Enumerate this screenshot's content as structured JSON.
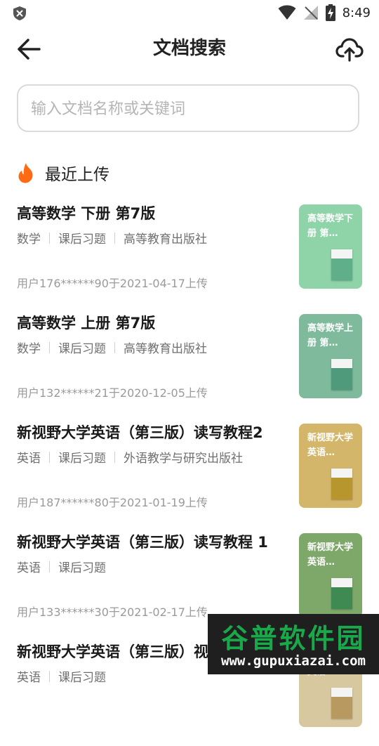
{
  "status_bar": {
    "time": "8:49"
  },
  "header": {
    "title": "文档搜索"
  },
  "search": {
    "placeholder": "输入文档名称或关键词"
  },
  "section": {
    "title": "最近上传"
  },
  "items": [
    {
      "title": "高等数学 下册 第7版",
      "tags": [
        "数学",
        "课后习题",
        "高等教育出版社"
      ],
      "meta": "用户176******90于2021-04-17上传",
      "thumb_title": "高等数学下册 第…",
      "thumb_color": "#8fd3a8",
      "book_color": "#5fb08a"
    },
    {
      "title": "高等数学 上册 第7版",
      "tags": [
        "数学",
        "课后习题",
        "高等教育出版社"
      ],
      "meta": "用户132******21于2020-12-05上传",
      "thumb_title": "高等数学上册 第…",
      "thumb_color": "#7fba9c",
      "book_color": "#4e9a7a"
    },
    {
      "title": "新视野大学英语（第三版）读写教程2",
      "tags": [
        "英语",
        "课后习题",
        "外语教学与研究出版社"
      ],
      "meta": "用户187******80于2021-01-19上传",
      "thumb_title": "新视野大学英语…",
      "thumb_color": "#d4b66a",
      "book_color": "#b8962e"
    },
    {
      "title": "新视野大学英语（第三版）读写教程 1",
      "tags": [
        "英语",
        "课后习题"
      ],
      "meta": "用户133******30于2021-02-17上传",
      "thumb_title": "新视野大学英语…",
      "thumb_color": "#7ea86a",
      "book_color": "#3f8a52"
    },
    {
      "title": "新视野大学英语（第三版）视听说",
      "tags": [
        "英语",
        "课后习题"
      ],
      "meta": "",
      "thumb_title": "新视野大学英语…",
      "thumb_color": "#d8c8a0",
      "book_color": "#b89a60"
    }
  ],
  "watermark": {
    "title": "谷普软件园",
    "url": "www.gupuxiazai.com"
  }
}
